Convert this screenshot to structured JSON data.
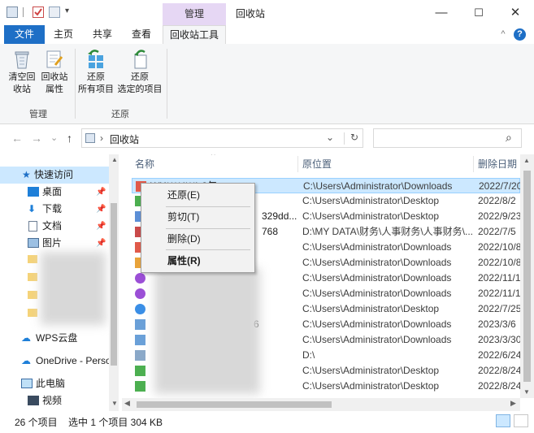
{
  "titlebar": {
    "manage_tab": "管理",
    "window_title": "回收站",
    "minimize": "—",
    "maximize": "☐",
    "close": "✕"
  },
  "ribbon_tabs": {
    "file": "文件",
    "home": "主页",
    "share": "共享",
    "view": "查看",
    "recycle_tools": "回收站工具",
    "collapse": "^",
    "help": "?"
  },
  "ribbon": {
    "empty_recycle_line1": "清空回",
    "empty_recycle_line2": "收站",
    "recycle_props_line1": "回收站",
    "recycle_props_line2": "属性",
    "restore_all_line1": "还原",
    "restore_all_line2": "所有项目",
    "restore_selected_line1": "还原",
    "restore_selected_line2": "选定的项目",
    "group_manage": "管理",
    "group_restore": "还原"
  },
  "address": {
    "back": "←",
    "forward": "→",
    "recent": "⌄",
    "up": "↑",
    "crumb_sep": "›",
    "location": "回收站",
    "dropdown": "⌄",
    "refresh": "↻",
    "search_icon": "⌕"
  },
  "navpane": {
    "quick_access": "快速访问",
    "items": [
      {
        "label": "桌面"
      },
      {
        "label": "下载"
      },
      {
        "label": "文档"
      },
      {
        "label": "图片"
      }
    ],
    "wps": "WPS云盘",
    "onedrive": "OneDrive - Perso",
    "this_pc": "此电脑",
    "videos": "视频"
  },
  "columns": {
    "name": "名称",
    "original_location": "原位置",
    "date_deleted": "删除日期"
  },
  "rows": [
    {
      "name": "WX****(***) 3年",
      "location": "C:\\Users\\Administrator\\Downloads",
      "date": "2022/7/20"
    },
    {
      "name": "",
      "location": "C:\\Users\\Administrator\\Desktop",
      "date": "2022/8/2"
    },
    {
      "name": "329dd...",
      "location": "C:\\Users\\Administrator\\Desktop",
      "date": "2022/9/23"
    },
    {
      "name": "768",
      "location": "D:\\MY DATA\\财务\\人事财务\\人事财务\\...",
      "date": "2022/7/5"
    },
    {
      "name": "",
      "location": "C:\\Users\\Administrator\\Downloads",
      "date": "2022/10/8"
    },
    {
      "name": "",
      "location": "C:\\Users\\Administrator\\Downloads",
      "date": "2022/10/8"
    },
    {
      "name": "",
      "location": "C:\\Users\\Administrator\\Downloads",
      "date": "2022/11/1"
    },
    {
      "name": "",
      "location": "C:\\Users\\Administrator\\Downloads",
      "date": "2022/11/1"
    },
    {
      "name": "",
      "location": "C:\\Users\\Administrator\\Desktop",
      "date": "2022/7/25"
    },
    {
      "name": "6",
      "location": "C:\\Users\\Administrator\\Downloads",
      "date": "2023/3/6"
    },
    {
      "name": "",
      "location": "C:\\Users\\Administrator\\Downloads",
      "date": "2023/3/30"
    },
    {
      "name": "",
      "location": "D:\\",
      "date": "2022/6/24"
    },
    {
      "name": "",
      "location": "C:\\Users\\Administrator\\Desktop",
      "date": "2022/8/24"
    },
    {
      "name": "",
      "location": "C:\\Users\\Administrator\\Desktop",
      "date": "2022/8/24"
    }
  ],
  "context_menu": {
    "restore": "还原(E)",
    "cut": "剪切(T)",
    "delete": "删除(D)",
    "properties": "属性(R)"
  },
  "status": {
    "item_count": "26 个项目",
    "selected": "选中 1 个项目  304 KB"
  },
  "colors": {
    "accent": "#1e6fc6",
    "manage_tab_bg": "#e6d7f4",
    "selection": "#cce8ff",
    "ribbon_bg": "#f5f6f7"
  }
}
